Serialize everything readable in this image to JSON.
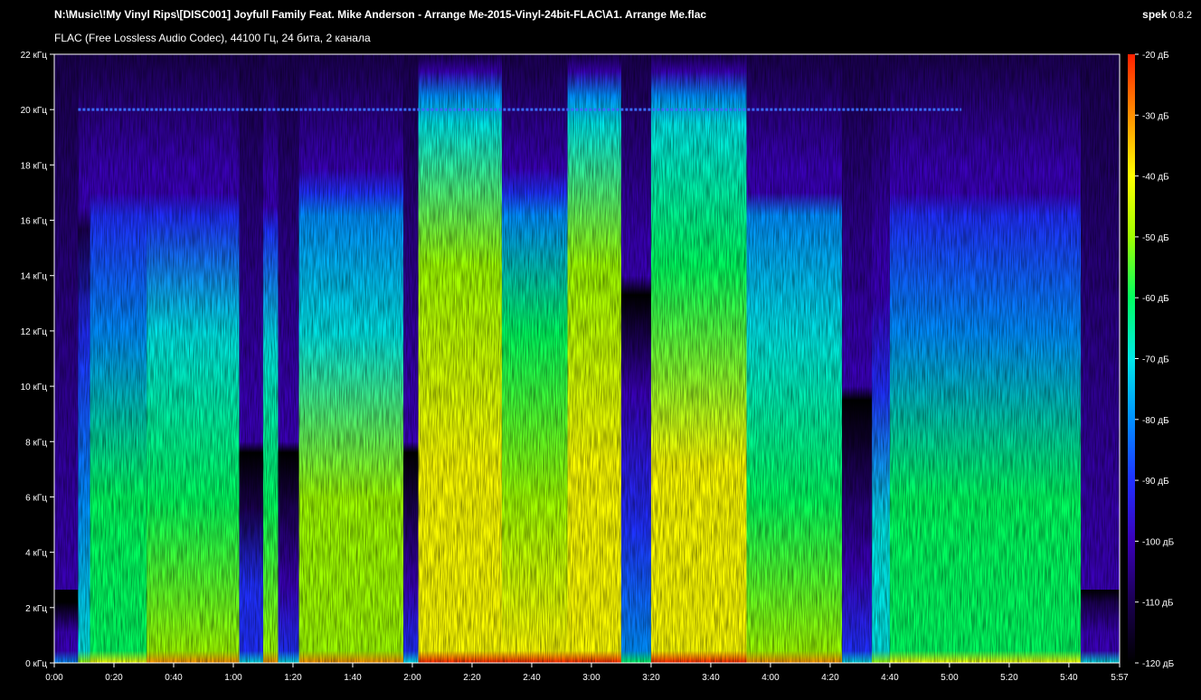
{
  "header": {
    "file_path": "N:\\Music\\!My Vinyl Rips\\[DISC001] Joyfull Family Feat. Mike Anderson - Arrange Me-2015-Vinyl-24bit-FLAC\\A1. Arrange Me.flac",
    "file_info": "FLAC (Free Lossless Audio Codec), 44100 Гц, 24 бита, 2 канала",
    "app_name": "spek",
    "app_version": "0.8.2"
  },
  "chart_data": {
    "type": "heatmap",
    "title": "",
    "x_axis": {
      "unit": "time (m:ss)",
      "range_seconds": [
        0,
        357
      ],
      "ticks": [
        "0:00",
        "0:20",
        "0:40",
        "1:00",
        "1:20",
        "1:40",
        "2:00",
        "2:20",
        "2:40",
        "3:00",
        "3:20",
        "3:40",
        "4:00",
        "4:20",
        "4:40",
        "5:00",
        "5:20",
        "5:40",
        "5:57"
      ],
      "tick_seconds": [
        0,
        20,
        40,
        60,
        80,
        100,
        120,
        140,
        160,
        180,
        200,
        220,
        240,
        260,
        280,
        300,
        320,
        340,
        357
      ]
    },
    "y_axis": {
      "unit": "кГц",
      "range": [
        0,
        22
      ],
      "ticks": [
        "0 кГц",
        "2 кГц",
        "4 кГц",
        "6 кГц",
        "8 кГц",
        "10 кГц",
        "12 кГц",
        "14 кГц",
        "16 кГц",
        "18 кГц",
        "20 кГц",
        "22 кГц"
      ],
      "tick_values": [
        0,
        2,
        4,
        6,
        8,
        10,
        12,
        14,
        16,
        18,
        20,
        22
      ]
    },
    "color_scale": {
      "unit": "дБ",
      "range": [
        -120,
        -20
      ],
      "ticks": [
        "-20 дБ",
        "-30 дБ",
        "-40 дБ",
        "-50 дБ",
        "-60 дБ",
        "-70 дБ",
        "-80 дБ",
        "-90 дБ",
        "-100 дБ",
        "-110 дБ",
        "-120 дБ"
      ],
      "tick_values": [
        -20,
        -30,
        -40,
        -50,
        -60,
        -70,
        -80,
        -90,
        -100,
        -110,
        -120
      ],
      "colors": [
        "#000000",
        "#1a0050",
        "#3a00b8",
        "#2030ff",
        "#0090ff",
        "#00e8e8",
        "#00ff60",
        "#a0ff00",
        "#ffff00",
        "#ff9000",
        "#ff2000"
      ]
    },
    "segments": [
      {
        "start": 0,
        "end": 8,
        "intensity": 0.15,
        "cutoff_khz": 1.5
      },
      {
        "start": 8,
        "end": 12,
        "intensity": 0.42,
        "cutoff_khz": 16.5
      },
      {
        "start": 12,
        "end": 31,
        "intensity": 0.55,
        "cutoff_khz": 17
      },
      {
        "start": 31,
        "end": 62,
        "intensity": 0.62,
        "cutoff_khz": 17
      },
      {
        "start": 62,
        "end": 70,
        "intensity": 0.25,
        "cutoff_khz": 8
      },
      {
        "start": 70,
        "end": 75,
        "intensity": 0.6,
        "cutoff_khz": 16.5
      },
      {
        "start": 75,
        "end": 82,
        "intensity": 0.2,
        "cutoff_khz": 8
      },
      {
        "start": 82,
        "end": 117,
        "intensity": 0.66,
        "cutoff_khz": 17
      },
      {
        "start": 117,
        "end": 122,
        "intensity": 0.22,
        "cutoff_khz": 8
      },
      {
        "start": 122,
        "end": 150,
        "intensity": 0.78,
        "cutoff_khz": 20.5
      },
      {
        "start": 150,
        "end": 172,
        "intensity": 0.72,
        "cutoff_khz": 17
      },
      {
        "start": 172,
        "end": 190,
        "intensity": 0.78,
        "cutoff_khz": 20.5
      },
      {
        "start": 190,
        "end": 200,
        "intensity": 0.3,
        "cutoff_khz": 14
      },
      {
        "start": 200,
        "end": 232,
        "intensity": 0.76,
        "cutoff_khz": 20.5
      },
      {
        "start": 232,
        "end": 264,
        "intensity": 0.64,
        "cutoff_khz": 17
      },
      {
        "start": 264,
        "end": 274,
        "intensity": 0.22,
        "cutoff_khz": 10
      },
      {
        "start": 274,
        "end": 280,
        "intensity": 0.45,
        "cutoff_khz": 14
      },
      {
        "start": 280,
        "end": 344,
        "intensity": 0.56,
        "cutoff_khz": 17
      },
      {
        "start": 344,
        "end": 357,
        "intensity": 0.18,
        "cutoff_khz": 2
      }
    ],
    "annotations": [
      {
        "type": "tone",
        "freq_khz": 20,
        "start": 8,
        "end": 304
      }
    ]
  }
}
